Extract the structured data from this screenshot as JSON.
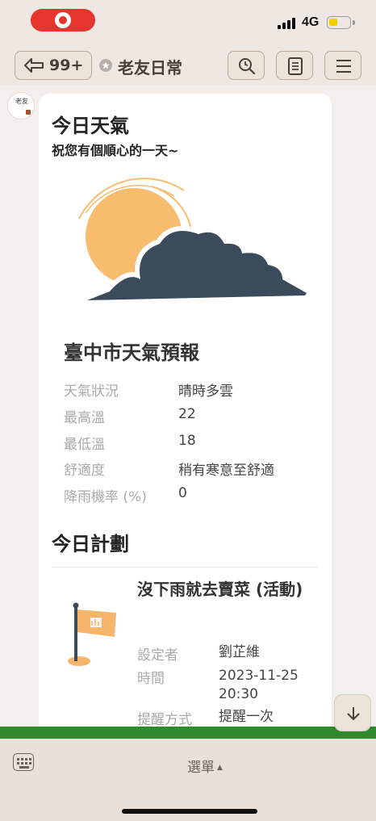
{
  "status_bar": {
    "network": "4G",
    "battery_fraction": 0.45
  },
  "nav": {
    "back_count": "99+",
    "title": "老友日常"
  },
  "avatar": {
    "text": "老友"
  },
  "card": {
    "title": "今日天氣",
    "subtitle": "祝您有個順心的一天~",
    "forecast_title": "臺中市天氣預報",
    "weather_rows": [
      {
        "label": "天氣狀況",
        "value": "晴時多雲"
      },
      {
        "label": "最高溫",
        "value": "22"
      },
      {
        "label": "最低溫",
        "value": "18"
      },
      {
        "label": "舒適度",
        "value": "稍有寒意至舒適"
      },
      {
        "label": "降雨機率 (%)",
        "value": "0"
      }
    ],
    "plan_title": "今日計劃",
    "event": {
      "title": "沒下雨就去賣菜 (活動)",
      "rows": [
        {
          "label": "設定者",
          "value": "劉芷維"
        },
        {
          "label": "時間",
          "value": "2023-11-25 20:30"
        },
        {
          "label": "提醒方式",
          "value": "提醒一次"
        }
      ]
    }
  },
  "bottom_bar": {
    "menu_label": "選單",
    "menu_caret": "▲"
  },
  "colors": {
    "sun": "#f7bc6e",
    "cloud": "#3b4b5c",
    "flag": "#f5b56a",
    "grass": "#2f8a2f",
    "record": "#e6342e"
  }
}
